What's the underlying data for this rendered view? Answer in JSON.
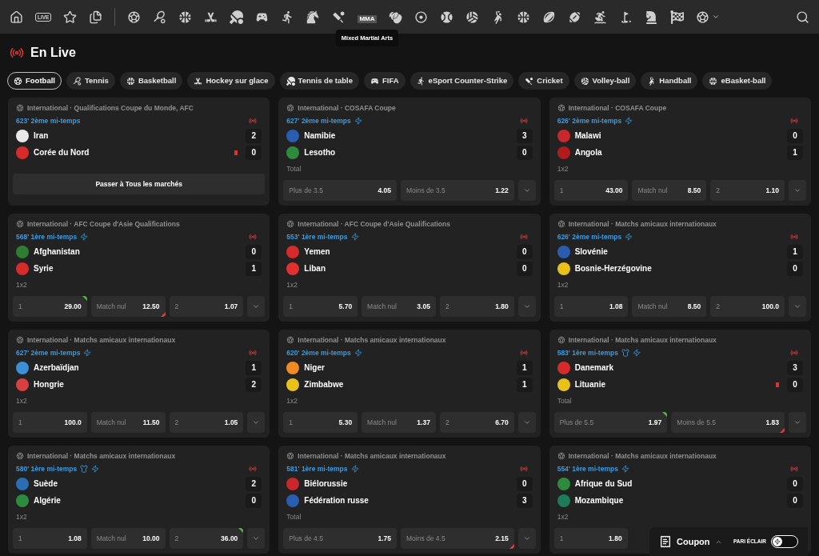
{
  "nav": {
    "live_badge": "LIVE",
    "mma_label": "MMA",
    "tooltip": "Mixed Martial Arts"
  },
  "page_title": "En Live",
  "sport_tabs": [
    {
      "label": "Football",
      "selected": true
    },
    {
      "label": "Tennis",
      "selected": false
    },
    {
      "label": "Basketball",
      "selected": false
    },
    {
      "label": "Hockey sur glace",
      "selected": false
    },
    {
      "label": "Tennis de table",
      "selected": false
    },
    {
      "label": "FIFA",
      "selected": false
    },
    {
      "label": "eSport Counter-Strike",
      "selected": false
    },
    {
      "label": "Cricket",
      "selected": false
    },
    {
      "label": "Volley-ball",
      "selected": false
    },
    {
      "label": "Handball",
      "selected": false
    },
    {
      "label": "eBasket-ball",
      "selected": false
    }
  ],
  "matches": [
    {
      "league": "International · Qualifications Coupe du Monde, AFC",
      "time": "623' 2ème mi-temps",
      "stream": false,
      "lineup": false,
      "teams": [
        {
          "name": "Iran",
          "score": "2",
          "color": "#e8e8e8",
          "red_card": false
        },
        {
          "name": "Corée du Nord",
          "score": "0",
          "color": "#d62b2b",
          "red_card": true
        }
      ],
      "all_markets": "Passer à Tous les marchés"
    },
    {
      "league": "International · COSAFA Coupe",
      "time": "627' 2ème mi-temps",
      "stream": true,
      "lineup": false,
      "teams": [
        {
          "name": "Namibie",
          "score": "3",
          "color": "#2a5db0",
          "red_card": false
        },
        {
          "name": "Lesotho",
          "score": "0",
          "color": "#2e8b3e",
          "red_card": false
        }
      ],
      "market": "Total",
      "odds": [
        {
          "label": "Plus de 3.5",
          "value": "4.05",
          "rising": false,
          "falling": false
        },
        {
          "label": "Moins de 3.5",
          "value": "1.22",
          "rising": false,
          "falling": false
        }
      ]
    },
    {
      "league": "International · COSAFA Coupe",
      "time": "626' 2ème mi-temps",
      "stream": true,
      "lineup": false,
      "teams": [
        {
          "name": "Malawi",
          "score": "0",
          "color": "#c8272b",
          "red_card": false
        },
        {
          "name": "Angola",
          "score": "1",
          "color": "#b01c1c",
          "red_card": false
        }
      ],
      "market": "1x2",
      "odds": [
        {
          "label": "1",
          "value": "43.00",
          "rising": false,
          "falling": false
        },
        {
          "label": "Match nul",
          "value": "8.50",
          "rising": false,
          "falling": false
        },
        {
          "label": "2",
          "value": "1.10",
          "rising": false,
          "falling": false
        }
      ]
    },
    {
      "league": "International · AFC Coupe d'Asie Qualifications",
      "time": "568' 1ère mi-temps",
      "stream": true,
      "lineup": false,
      "teams": [
        {
          "name": "Afghanistan",
          "score": "0",
          "color": "#2e7d32",
          "red_card": false
        },
        {
          "name": "Syrie",
          "score": "1",
          "color": "#d62b2b",
          "red_card": false
        }
      ],
      "market": "1x2",
      "odds": [
        {
          "label": "1",
          "value": "29.00",
          "rising": true,
          "falling": false
        },
        {
          "label": "Match nul",
          "value": "12.50",
          "rising": false,
          "falling": true
        },
        {
          "label": "2",
          "value": "1.07",
          "rising": false,
          "falling": false
        }
      ]
    },
    {
      "league": "International · AFC Coupe d'Asie Qualifications",
      "time": "553' 1ère mi-temps",
      "stream": true,
      "lineup": false,
      "teams": [
        {
          "name": "Yemen",
          "score": "0",
          "color": "#d62b2b",
          "red_card": false
        },
        {
          "name": "Liban",
          "score": "0",
          "color": "#e03030",
          "red_card": false
        }
      ],
      "market": "1x2",
      "odds": [
        {
          "label": "1",
          "value": "5.70",
          "rising": false,
          "falling": false
        },
        {
          "label": "Match nul",
          "value": "3.05",
          "rising": false,
          "falling": false
        },
        {
          "label": "2",
          "value": "1.80",
          "rising": false,
          "falling": false
        }
      ]
    },
    {
      "league": "International · Matchs amicaux internationaux",
      "time": "626' 2ème mi-temps",
      "stream": true,
      "lineup": false,
      "teams": [
        {
          "name": "Slovénie",
          "score": "1",
          "color": "#2a5db0",
          "red_card": false
        },
        {
          "name": "Bosnie-Herzégovine",
          "score": "0",
          "color": "#e8c21a",
          "red_card": false
        }
      ],
      "market": "1x2",
      "odds": [
        {
          "label": "1",
          "value": "1.08",
          "rising": false,
          "falling": false
        },
        {
          "label": "Match nul",
          "value": "8.50",
          "rising": false,
          "falling": false
        },
        {
          "label": "2",
          "value": "100.0",
          "rising": false,
          "falling": false
        }
      ]
    },
    {
      "league": "International · Matchs amicaux internationaux",
      "time": "627' 2ème mi-temps",
      "stream": true,
      "lineup": false,
      "teams": [
        {
          "name": "Azerbaïdjan",
          "score": "1",
          "color": "#3a8fd6",
          "red_card": false
        },
        {
          "name": "Hongrie",
          "score": "2",
          "color": "#d64040",
          "red_card": false
        }
      ],
      "market": "1x2",
      "odds": [
        {
          "label": "1",
          "value": "100.0",
          "rising": false,
          "falling": false
        },
        {
          "label": "Match nul",
          "value": "11.50",
          "rising": false,
          "falling": false
        },
        {
          "label": "2",
          "value": "1.05",
          "rising": false,
          "falling": false
        }
      ]
    },
    {
      "league": "International · Matchs amicaux internationaux",
      "time": "620' 2ème mi-temps",
      "stream": true,
      "lineup": false,
      "teams": [
        {
          "name": "Niger",
          "score": "1",
          "color": "#f08a24",
          "red_card": false
        },
        {
          "name": "Zimbabwe",
          "score": "1",
          "color": "#e8c21a",
          "red_card": false
        }
      ],
      "market": "1x2",
      "odds": [
        {
          "label": "1",
          "value": "5.30",
          "rising": false,
          "falling": false
        },
        {
          "label": "Match nul",
          "value": "1.37",
          "rising": false,
          "falling": false
        },
        {
          "label": "2",
          "value": "6.70",
          "rising": false,
          "falling": false
        }
      ]
    },
    {
      "league": "International · Matchs amicaux internationaux",
      "time": "583' 1ère mi-temps",
      "stream": true,
      "lineup": true,
      "teams": [
        {
          "name": "Danemark",
          "score": "3",
          "color": "#d62b2b",
          "red_card": false
        },
        {
          "name": "Lituanie",
          "score": "0",
          "color": "#e8c21a",
          "red_card": true
        }
      ],
      "market": "Total",
      "odds": [
        {
          "label": "Plus de 5.5",
          "value": "1.97",
          "rising": true,
          "falling": false
        },
        {
          "label": "Moins de 5.5",
          "value": "1.83",
          "rising": false,
          "falling": true
        }
      ]
    },
    {
      "league": "International · Matchs amicaux internationaux",
      "time": "580' 1ère mi-temps",
      "stream": true,
      "lineup": true,
      "teams": [
        {
          "name": "Suède",
          "score": "2",
          "color": "#2a6db0",
          "red_card": false
        },
        {
          "name": "Algérie",
          "score": "0",
          "color": "#2e8b3e",
          "red_card": false
        }
      ],
      "market": "1x2",
      "odds": [
        {
          "label": "1",
          "value": "1.08",
          "rising": false,
          "falling": false
        },
        {
          "label": "Match nul",
          "value": "10.00",
          "rising": false,
          "falling": false
        },
        {
          "label": "2",
          "value": "36.00",
          "rising": true,
          "falling": false
        }
      ]
    },
    {
      "league": "International · Matchs amicaux internationaux",
      "time": "581' 1ère mi-temps",
      "stream": true,
      "lineup": false,
      "teams": [
        {
          "name": "Biélorussie",
          "score": "0",
          "color": "#c8272b",
          "red_card": false
        },
        {
          "name": "Fédération russe",
          "score": "3",
          "color": "#2a5db0",
          "red_card": false
        }
      ],
      "market": "Total",
      "odds": [
        {
          "label": "Plus de 4.5",
          "value": "1.75",
          "rising": false,
          "falling": false
        },
        {
          "label": "Moins de 4.5",
          "value": "2.15",
          "rising": false,
          "falling": true
        }
      ]
    },
    {
      "league": "International · Matchs amicaux internationaux",
      "time": "554' 1ère mi-temps",
      "stream": true,
      "lineup": false,
      "teams": [
        {
          "name": "Afrique du Sud",
          "score": "0",
          "color": "#2e8b3e",
          "red_card": false
        },
        {
          "name": "Mozambique",
          "score": "0",
          "color": "#1f7a5a",
          "red_card": false
        }
      ],
      "market": "1x2",
      "odds": [
        {
          "label": "1",
          "value": "1.80",
          "rising": false,
          "falling": false
        }
      ]
    }
  ],
  "coupon": {
    "label": "Coupon",
    "flash_label": "PARI ÉCLAIR",
    "flash_on": false
  }
}
